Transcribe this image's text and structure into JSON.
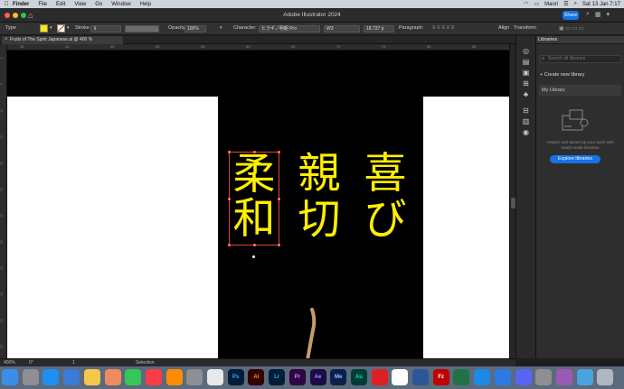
{
  "menubar": {
    "apple": "",
    "items": [
      "Finder",
      "File",
      "Edit",
      "View",
      "Go",
      "Window",
      "Help"
    ],
    "user": "Maori",
    "clock": "Sat 13 Jan  7:17"
  },
  "titlebar": {
    "title": "Adobe Illustrator 2024",
    "share": "Share"
  },
  "control_bar": {
    "type_label": "Type",
    "stroke_label": "Stroke",
    "opacity_label": "Opacity:",
    "opacity_value": "100%",
    "character_label": "Character:",
    "font_family": "ヒラギノ明朝 Pro",
    "font_style": "W3",
    "font_size": "18.737 p",
    "paragraph_label": "Paragraph:",
    "align_label": "Align",
    "transform_label": "Transform",
    "fill_color": "#ffea00"
  },
  "document": {
    "tab_title": "Fruits of The Spirit Japanese.ai @ 400 % (CMYK/Preview)"
  },
  "rulers": {
    "horizontal": [
      "35",
      "40",
      "45",
      "50",
      "55",
      "60",
      "65",
      "70",
      "75",
      "80",
      "85"
    ],
    "vertical": [
      "0",
      "5",
      "10",
      "15",
      "20",
      "25",
      "30",
      "35",
      "40",
      "45",
      "50",
      "55"
    ]
  },
  "artwork": {
    "col1": [
      "柔",
      "和"
    ],
    "col2": [
      "親",
      "切"
    ],
    "col3": [
      "喜",
      "び"
    ],
    "text_color": "#ffef00"
  },
  "libraries": {
    "panel_title": "Libraries",
    "search_placeholder": "Search all libraries",
    "create_label": "Create new library",
    "my_library": "My Library",
    "description": "Inspire and speed up your work with ready-made libraries.",
    "explore_button": "Explore libraries"
  },
  "statusbar": {
    "zoom": "400%",
    "rotation": "0°",
    "artboard": "1",
    "tool": "Selection"
  },
  "dock": {
    "apps": [
      "Finder",
      "Launchpad",
      "Safari",
      "Mail",
      "Notes",
      "Photos",
      "Messages",
      "Music",
      "VLC",
      "Settings",
      "Chrome",
      "Ps",
      "Ai",
      "Lr",
      "Pr",
      "Ae",
      "Me",
      "Au",
      "Acrobat",
      "Calendar",
      "Word",
      "FileZilla",
      "Excel",
      "App Store",
      "Mail2",
      "Discord",
      "Preview",
      "Podcasts",
      "Finder2",
      "Bin"
    ]
  }
}
